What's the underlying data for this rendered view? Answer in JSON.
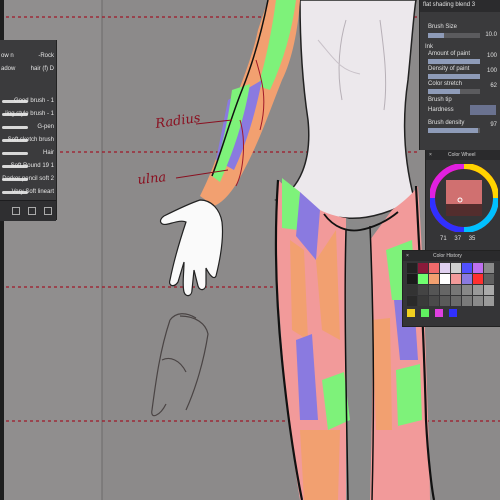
{
  "brush_panel": {
    "items": [
      {
        "label": "-Rock"
      },
      {
        "label": "hair (f) D"
      },
      {
        "label": "Good brush - 1"
      },
      {
        "label": "ling style brush - 1"
      },
      {
        "label": "G-pen"
      },
      {
        "label": "Soft sketch brush"
      },
      {
        "label": "Hair"
      },
      {
        "label": "Soft Round 19 1"
      },
      {
        "label": "Darker pencil soft 2"
      },
      {
        "label": "Very Soft lineart"
      }
    ],
    "row_prefixes": [
      "ow n",
      "adow"
    ]
  },
  "tool_panel": {
    "brush_name": "flat shading blend 3",
    "brush_size_label": "Brush Size",
    "brush_size_value": "10.0",
    "ink_label": "Ink",
    "amount_label": "Amount of paint",
    "amount_value": "100",
    "density_label": "Density of paint",
    "density_value": "100",
    "stretch_label": "Color stretch",
    "stretch_value": "62",
    "tip_label": "Brush tip",
    "hardness_label": "Hardness",
    "brush_density_label": "Brush density",
    "brush_density_value": "97"
  },
  "color_wheel": {
    "title": "Color Wheel",
    "values": [
      "71",
      "37",
      "35"
    ]
  },
  "color_history": {
    "title": "Color History"
  },
  "annotations": {
    "radius": "Radius",
    "ulna": "ulna"
  },
  "colors": {
    "bone_purple": "#8a7ae0",
    "muscle_pink": "#f29a9a",
    "muscle_green": "#7ef27a",
    "muscle_orange": "#f2a070",
    "guide_red": "#a01828",
    "annotation": "#8a1020"
  }
}
